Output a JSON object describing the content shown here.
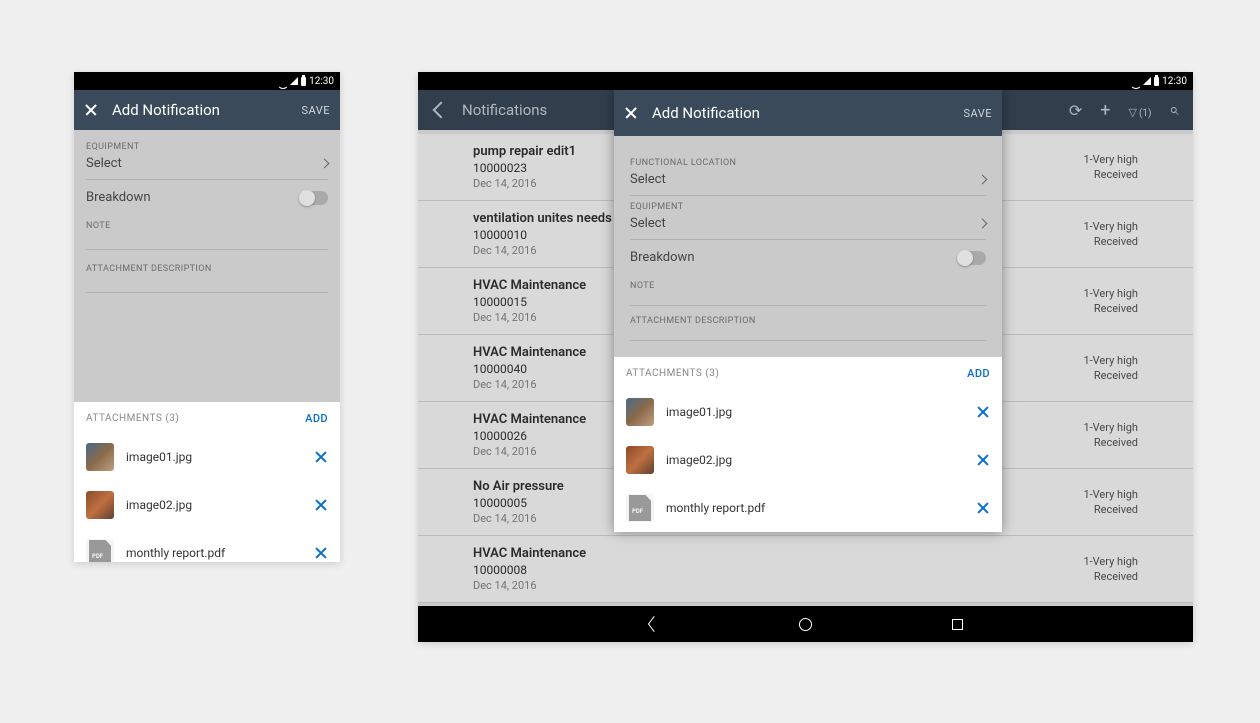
{
  "status": {
    "time": "12:30"
  },
  "phone": {
    "title": "Add Notification",
    "save": "SAVE",
    "equipment_label": "EQUIPMENT",
    "equipment_value": "Select",
    "breakdown_label": "Breakdown",
    "note_label": "NOTE",
    "attach_desc_label": "ATTACHMENT DESCRIPTION",
    "attachments_label": "ATTACHMENTS (3)",
    "add_label": "ADD",
    "files": [
      {
        "name": "image01.jpg",
        "type": "img1"
      },
      {
        "name": "image02.jpg",
        "type": "img2"
      },
      {
        "name": "monthly report.pdf",
        "type": "pdf"
      }
    ]
  },
  "tablet": {
    "back_title": "Notifications",
    "filter_count": "(1)",
    "list": [
      {
        "title": "pump repair edit1",
        "id": "10000023",
        "date": "Dec 14, 2016",
        "priority": "1-Very high",
        "status": "Received"
      },
      {
        "title": "ventilation unites needs",
        "id": "10000010",
        "date": "Dec 14, 2016",
        "priority": "1-Very high",
        "status": "Received"
      },
      {
        "title": "HVAC Maintenance",
        "id": "10000015",
        "date": "Dec 14, 2016",
        "priority": "1-Very high",
        "status": "Received"
      },
      {
        "title": "HVAC Maintenance",
        "id": "10000040",
        "date": "Dec 14, 2016",
        "priority": "1-Very high",
        "status": "Received"
      },
      {
        "title": "HVAC Maintenance",
        "id": "10000026",
        "date": "Dec 14, 2016",
        "priority": "1-Very high",
        "status": "Received"
      },
      {
        "title": "No Air pressure",
        "id": "10000005",
        "date": "Dec 14, 2016",
        "priority": "1-Very high",
        "status": "Received"
      },
      {
        "title": "HVAC Maintenance",
        "id": "10000008",
        "date": "Dec 14, 2016",
        "priority": "1-Very high",
        "status": "Received"
      }
    ],
    "dialog": {
      "title": "Add Notification",
      "save": "SAVE",
      "func_loc_label": "FUNCTIONAL LOCATION",
      "func_loc_value": "Select",
      "equipment_label": "EQUIPMENT",
      "equipment_value": "Select",
      "breakdown_label": "Breakdown",
      "note_label": "NOTE",
      "attach_desc_label": "ATTACHMENT DESCRIPTION",
      "attachments_label": "ATTACHMENTS (3)",
      "add_label": "ADD",
      "files": [
        {
          "name": "image01.jpg",
          "type": "img1"
        },
        {
          "name": "image02.jpg",
          "type": "img2"
        },
        {
          "name": "monthly report.pdf",
          "type": "pdf"
        }
      ]
    }
  }
}
